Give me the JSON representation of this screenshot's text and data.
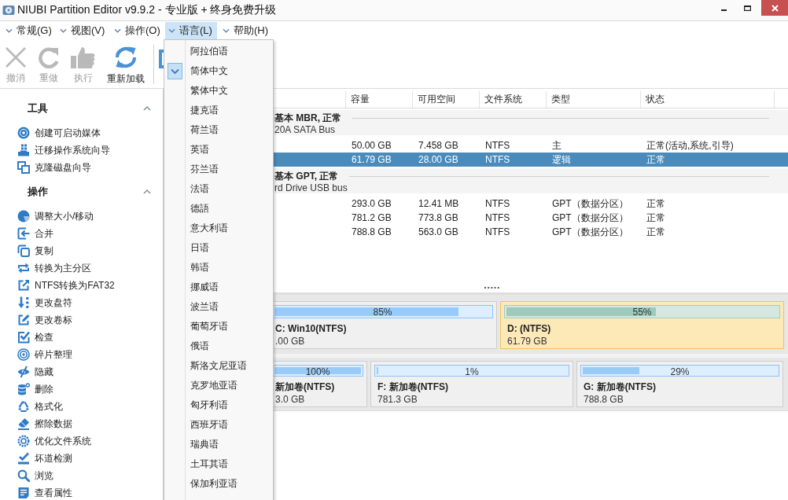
{
  "window": {
    "title": "NIUBI Partition Editor v9.9.2 - 专业版 + 终身免费升级"
  },
  "menu_bar": [
    {
      "label": "常规(G)",
      "selected": false
    },
    {
      "label": "视图(V)",
      "selected": false
    },
    {
      "label": "操作(O)",
      "selected": false
    },
    {
      "label": "语言(L)",
      "selected": true
    },
    {
      "label": "帮助(H)",
      "selected": false
    }
  ],
  "language_menu": {
    "items": [
      {
        "label": "阿拉伯语",
        "checked": false
      },
      {
        "label": "简体中文",
        "checked": true
      },
      {
        "label": "繁体中文",
        "checked": false
      },
      {
        "label": "捷克语",
        "checked": false
      },
      {
        "label": "荷兰语",
        "checked": false
      },
      {
        "label": "英语",
        "checked": false
      },
      {
        "label": "芬兰语",
        "checked": false
      },
      {
        "label": "法语",
        "checked": false
      },
      {
        "label": "德語",
        "checked": false
      },
      {
        "label": "意大利语",
        "checked": false
      },
      {
        "label": "日语",
        "checked": false
      },
      {
        "label": "韩语",
        "checked": false
      },
      {
        "label": "挪威语",
        "checked": false
      },
      {
        "label": "波兰语",
        "checked": false
      },
      {
        "label": "葡萄牙语",
        "checked": false
      },
      {
        "label": "俄语",
        "checked": false
      },
      {
        "label": "斯洛文尼亚语",
        "checked": false
      },
      {
        "label": "克罗地亚语",
        "checked": false
      },
      {
        "label": "匈牙利语",
        "checked": false
      },
      {
        "label": "西班牙语",
        "checked": false
      },
      {
        "label": "瑞典语",
        "checked": false
      },
      {
        "label": "土耳其语",
        "checked": false
      },
      {
        "label": "保加利亚语",
        "checked": false
      }
    ]
  },
  "toolbar": [
    {
      "label": "撤消",
      "kind": "undo",
      "disabled": true
    },
    {
      "label": "重做",
      "kind": "redo",
      "disabled": true
    },
    {
      "label": "执行",
      "kind": "apply",
      "disabled": true
    },
    {
      "label": "重新加载",
      "kind": "reload",
      "disabled": false
    }
  ],
  "sidebar": {
    "sections": [
      {
        "title": "工具",
        "expanded": true,
        "items": [
          {
            "label": "创建可启动媒体",
            "kind": "media"
          },
          {
            "label": "迁移操作系统向导",
            "kind": "migrate"
          },
          {
            "label": "克隆磁盘向导",
            "kind": "clone"
          }
        ]
      },
      {
        "title": "操作",
        "expanded": true,
        "items": [
          {
            "label": "调整大小/移动",
            "kind": "resize"
          },
          {
            "label": "合并",
            "kind": "merge"
          },
          {
            "label": "复制",
            "kind": "copy"
          },
          {
            "label": "转换为主分区",
            "kind": "convert"
          },
          {
            "label": "NTFS转换为FAT32",
            "kind": "export"
          },
          {
            "label": "更改盘符",
            "kind": "letter"
          },
          {
            "label": "更改卷标",
            "kind": "label"
          },
          {
            "label": "检查",
            "kind": "check"
          },
          {
            "label": "碎片整理",
            "kind": "defrag"
          },
          {
            "label": "隐藏",
            "kind": "hide"
          },
          {
            "label": "删除",
            "kind": "delete"
          },
          {
            "label": "格式化",
            "kind": "format"
          },
          {
            "label": "擦除数据",
            "kind": "wipe"
          },
          {
            "label": "优化文件系统",
            "kind": "optimize"
          },
          {
            "label": "坏道检测",
            "kind": "scan"
          },
          {
            "label": "浏览",
            "kind": "browse"
          },
          {
            "label": "查看属性",
            "kind": "properties"
          }
        ]
      }
    ]
  },
  "table": {
    "columns": [
      "容量",
      "可用空间",
      "文件系统",
      "类型",
      "状态"
    ],
    "disks": [
      {
        "title": "基本 MBR, 正常",
        "subtitle": "20A SATA Bus",
        "rows": [
          {
            "selected": false,
            "cells": [
              "50.00 GB",
              "7.458 GB",
              "NTFS",
              "主",
              "正常(活动,系统,引导)"
            ]
          },
          {
            "selected": true,
            "cells": [
              "61.79 GB",
              "28.00 GB",
              "NTFS",
              "逻辑",
              "正常"
            ]
          }
        ]
      },
      {
        "title": "基本 GPT, 正常",
        "subtitle": "rd Drive USB bus",
        "rows": [
          {
            "selected": false,
            "cells": [
              "293.0 GB",
              "12.41 MB",
              "NTFS",
              "GPT（数据分区）",
              "正常"
            ]
          },
          {
            "selected": false,
            "cells": [
              "781.2 GB",
              "773.8 GB",
              "NTFS",
              "GPT（数据分区）",
              "正常"
            ]
          },
          {
            "selected": false,
            "cells": [
              "788.8 GB",
              "563.0 GB",
              "NTFS",
              "GPT（数据分区）",
              "正常"
            ]
          }
        ]
      }
    ]
  },
  "disk_map": [
    {
      "partitions": [
        {
          "label": "C: Win10(NTFS)",
          "size": ".00 GB",
          "usage": "85%",
          "level": 0.85,
          "selected": false
        },
        {
          "label": "D: (NTFS)",
          "size": "61.79 GB",
          "usage": "55%",
          "level": 0.55,
          "selected": true
        }
      ]
    },
    {
      "partitions": [
        {
          "label": "新加卷(NTFS)",
          "size": "3.0 GB",
          "usage": "100%",
          "level": 1,
          "selected": false
        },
        {
          "label": "F: 新加卷(NTFS)",
          "size": "781.3 GB",
          "usage": "1%",
          "level": 0.01,
          "selected": false
        },
        {
          "label": "G: 新加卷(NTFS)",
          "size": "788.8 GB",
          "usage": "29%",
          "level": 0.29,
          "selected": false
        }
      ]
    }
  ]
}
